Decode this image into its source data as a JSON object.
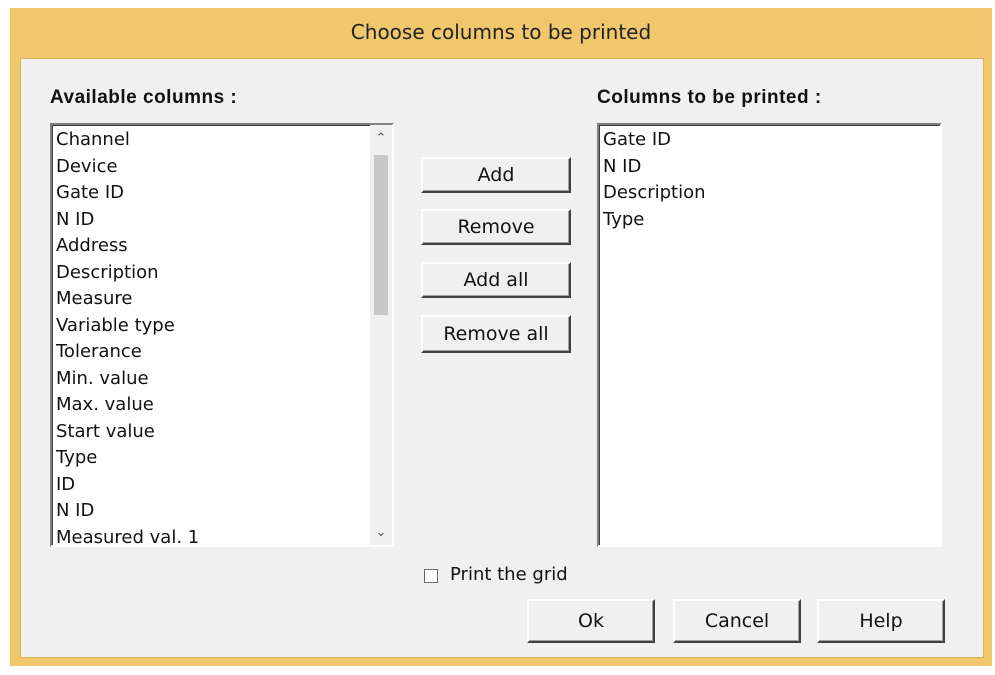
{
  "window": {
    "title": "Choose columns to be printed"
  },
  "available": {
    "label": "Available columns :",
    "items": [
      "Channel",
      "Device",
      "Gate ID",
      "N ID",
      "Address",
      "Description",
      "Measure",
      "Variable type",
      "Tolerance",
      "Min. value",
      "Max. value",
      "Start value",
      "Type",
      "ID",
      "N ID",
      "Measured val. 1"
    ]
  },
  "printed": {
    "label": "Columns to be printed :",
    "items": [
      "Gate ID",
      "N ID",
      "Description",
      "Type"
    ]
  },
  "buttons": {
    "add": "Add",
    "remove": "Remove",
    "add_all": "Add all",
    "remove_all": "Remove all",
    "ok": "Ok",
    "cancel": "Cancel",
    "help": "Help"
  },
  "options": {
    "print_grid_label": "Print the grid",
    "print_grid_checked": false
  },
  "icons": {
    "scroll_up": "scroll-up-arrow-icon",
    "scroll_down": "scroll-down-arrow-icon"
  },
  "colors": {
    "title_bar": "#f0c76a",
    "dialog_bg": "#f0f0f0"
  }
}
